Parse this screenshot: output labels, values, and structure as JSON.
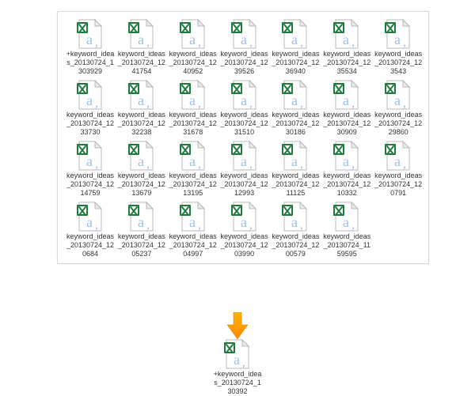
{
  "grid": {
    "files": [
      {
        "name": "+keyword_ideas_20130724_1303929"
      },
      {
        "name": "keyword_ideas_20130724_1241754"
      },
      {
        "name": "keyword_ideas_20130724_1240952"
      },
      {
        "name": "keyword_ideas_20130724_1239526"
      },
      {
        "name": "keyword_ideas_20130724_1236940"
      },
      {
        "name": "keyword_ideas_20130724_1235534"
      },
      {
        "name": "keyword_ideas_20130724_123543"
      },
      {
        "name": "keyword_ideas_20130724_1233730"
      },
      {
        "name": "keyword_ideas_20130724_1232238"
      },
      {
        "name": "keyword_ideas_20130724_1231678"
      },
      {
        "name": "keyword_ideas_20130724_1231510"
      },
      {
        "name": "keyword_ideas_20130724_1230186"
      },
      {
        "name": "keyword_ideas_20130724_1230909"
      },
      {
        "name": "keyword_ideas_20130724_1229860"
      },
      {
        "name": "keyword_ideas_20130724_1214759"
      },
      {
        "name": "keyword_ideas_20130724_1213679"
      },
      {
        "name": "keyword_ideas_20130724_1213195"
      },
      {
        "name": "keyword_ideas_20130724_1212993"
      },
      {
        "name": "keyword_ideas_20130724_1211125"
      },
      {
        "name": "keyword_ideas_20130724_1210332"
      },
      {
        "name": "keyword_ideas_20130724_120791"
      },
      {
        "name": "keyword_ideas_20130724_120684"
      },
      {
        "name": "keyword_ideas_20130724_1205237"
      },
      {
        "name": "keyword_ideas_20130724_1204997"
      },
      {
        "name": "keyword_ideas_20130724_1203990"
      },
      {
        "name": "keyword_ideas_20130724_1200579"
      },
      {
        "name": "keyword_ideas_20130724_1159595"
      }
    ]
  },
  "result_file": {
    "name": "+keyword_ideas_20130724_130392"
  },
  "icons": {
    "csv": "excel-csv-icon",
    "arrow": "merge-arrow-icon"
  },
  "colors": {
    "excel_green": "#1f7a3e",
    "csv_blue": "#6fa1d8",
    "arrow": "#ff9a00"
  }
}
